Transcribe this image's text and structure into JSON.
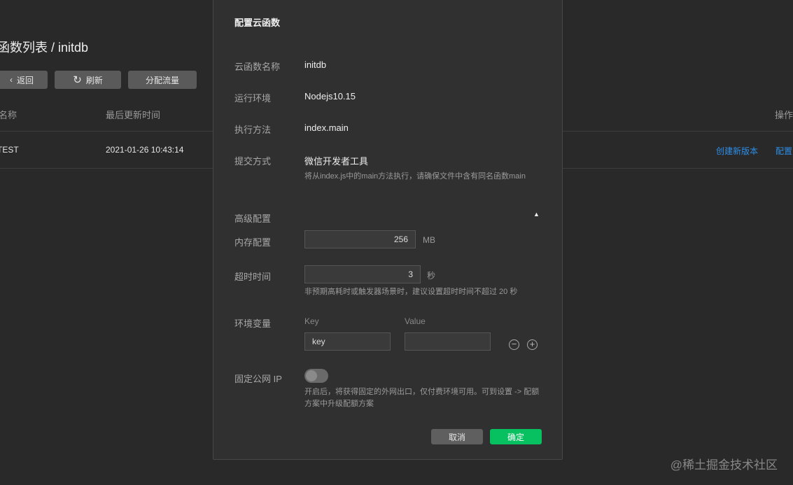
{
  "page": {
    "title": "函数列表 / initdb",
    "buttons": {
      "back": "返回",
      "refresh": "刷新",
      "traffic": "分配流量"
    },
    "table": {
      "headers": [
        "名称",
        "最后更新时间",
        "操作"
      ],
      "rows": [
        {
          "name": "TEST",
          "updated": "2021-01-26 10:43:14",
          "actions": [
            "创建新版本",
            "配置"
          ]
        }
      ]
    }
  },
  "modal": {
    "title": "配置云函数",
    "fields": {
      "name_label": "云函数名称",
      "name": "initdb",
      "runtime_label": "运行环境",
      "runtime": "Nodejs10.15",
      "handler_label": "执行方法",
      "handler": "index.main",
      "submit_label": "提交方式",
      "submit": "微信开发者工具",
      "submit_hint": "将从index.js中的main方法执行，请确保文件中含有同名函数main"
    },
    "advanced": {
      "label": "高级配置",
      "memory_label": "内存配置",
      "memory": "256",
      "memory_unit": "MB",
      "timeout_label": "超时时间",
      "timeout": "3",
      "timeout_unit": "秒",
      "timeout_hint": "非预期高耗时或触发器场景时，建议设置超时时间不超过 20 秒",
      "env_label": "环境变量",
      "key_header": "Key",
      "value_header": "Value",
      "key_value": "key",
      "value_value": "",
      "ip_label": "固定公网 IP",
      "ip_enabled": false,
      "ip_hint": "开启后，将获得固定的外网出口，仅付费环境可用。可到设置 -> 配额方案中升级配额方案"
    },
    "cancel": "取消",
    "confirm": "确定"
  },
  "watermark": "@稀土掘金技术社区",
  "colors": {
    "accent": "#07c160",
    "link": "#2e8ee8"
  }
}
